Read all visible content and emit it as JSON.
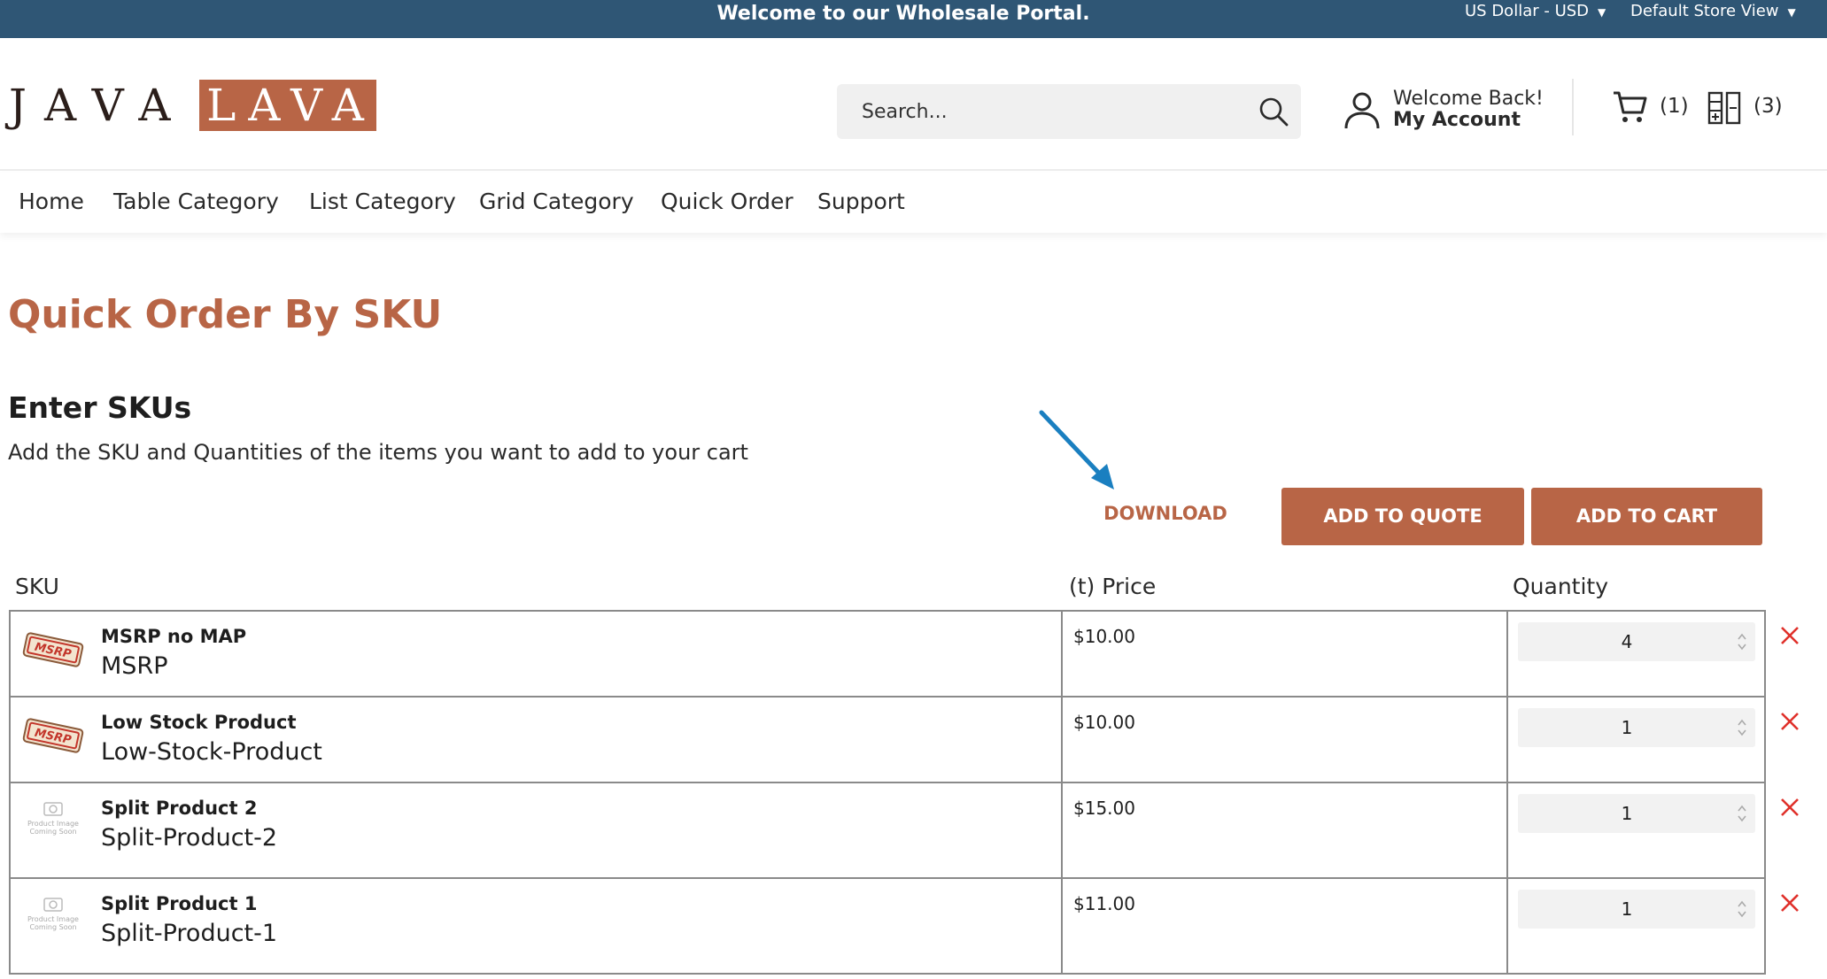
{
  "topbar": {
    "welcome": "Welcome to our Wholesale Portal.",
    "currency": "US Dollar - USD",
    "store_view": "Default Store View",
    "caret": "▼"
  },
  "header": {
    "logo_java": "JAVA",
    "logo_lava": "LAVA",
    "search_placeholder": "Search...",
    "account_greeting": "Welcome Back!",
    "account_label": "My Account",
    "cart_count": "(1)",
    "compare_count": "(3)"
  },
  "nav": {
    "items": [
      "Home",
      "Table Category",
      "List Category",
      "Grid Category",
      "Quick Order",
      "Support"
    ]
  },
  "main": {
    "title": "Quick Order By SKU",
    "section_title": "Enter SKUs",
    "section_desc": "Add the SKU and Quantities of the items you want to add to your cart",
    "download_label": "DOWNLOAD",
    "add_to_quote_label": "ADD TO QUOTE",
    "add_to_cart_label": "ADD TO CART",
    "columns": {
      "sku": "SKU",
      "price": "(t) Price",
      "quantity": "Quantity"
    }
  },
  "rows": [
    {
      "name": "MSRP no MAP",
      "sku": "MSRP",
      "price": "$10.00",
      "qty": "4",
      "thumb": "msrp-tag"
    },
    {
      "name": "Low Stock Product",
      "sku": "Low-Stock-Product",
      "price": "$10.00",
      "qty": "1",
      "thumb": "msrp-tag"
    },
    {
      "name": "Split Product 2",
      "sku": "Split-Product-2",
      "price": "$15.00",
      "qty": "1",
      "thumb": "coming-soon"
    },
    {
      "name": "Split Product 1",
      "sku": "Split-Product-1",
      "price": "$11.00",
      "qty": "1",
      "thumb": "coming-soon"
    }
  ],
  "thumb_text": {
    "msrp": "MSRP",
    "coming_soon_1": "Product Image",
    "coming_soon_2": "Coming Soon"
  },
  "colors": {
    "topbar": "#2f5675",
    "accent": "#b86546",
    "remove": "#e0302a",
    "arrow": "#1a7fc0"
  }
}
